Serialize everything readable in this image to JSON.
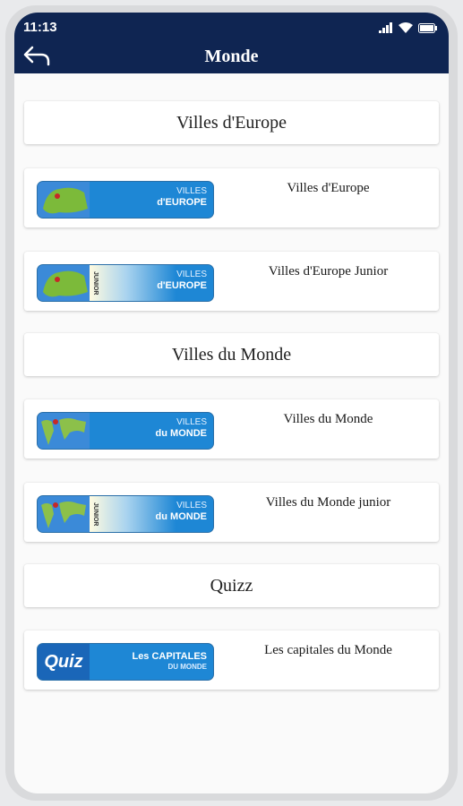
{
  "status_bar": {
    "time": "11:13"
  },
  "header": {
    "title": "Monde"
  },
  "sections": [
    {
      "title": "Villes d'Europe"
    },
    {
      "title": "Villes du Monde"
    },
    {
      "title": "Quizz"
    }
  ],
  "games": [
    {
      "label": "Villes d'Europe",
      "banner_line1": "VILLES",
      "banner_line2": "d'EUROPE"
    },
    {
      "label": "Villes d'Europe Junior",
      "banner_line1": "VILLES",
      "banner_line2": "d'EUROPE",
      "badge": "JUNIOR"
    },
    {
      "label": "Villes du Monde",
      "banner_line1": "VILLES",
      "banner_line2": "du MONDE"
    },
    {
      "label": "Villes du Monde junior",
      "banner_line1": "VILLES",
      "banner_line2": "du MONDE",
      "badge": "JUNIOR"
    },
    {
      "label": "Les capitales du Monde",
      "banner_line1": "Les CAPITALES",
      "banner_line2": "DU MONDE",
      "logo": "Quiz"
    }
  ],
  "colors": {
    "header": "#0f2552",
    "banner_blue": "#1e87d5"
  },
  "icons": [
    "back-arrow-icon",
    "signal-icon",
    "wifi-icon",
    "battery-icon"
  ]
}
